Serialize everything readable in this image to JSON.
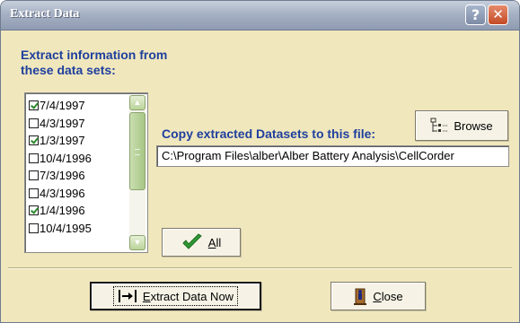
{
  "window": {
    "title": "Extract Data",
    "help_label": "?",
    "close_label": "✕"
  },
  "datasets": {
    "header_line1": "Extract information from",
    "header_line2": "these data sets:",
    "items": [
      {
        "label": "7/4/1997",
        "checked": true
      },
      {
        "label": "4/3/1997",
        "checked": false
      },
      {
        "label": "1/3/1997",
        "checked": true
      },
      {
        "label": "10/4/1996",
        "checked": false
      },
      {
        "label": "7/3/1996",
        "checked": false
      },
      {
        "label": "4/3/1996",
        "checked": false
      },
      {
        "label": "1/4/1996",
        "checked": true
      },
      {
        "label": "10/4/1995",
        "checked": false
      }
    ]
  },
  "copy": {
    "label": "Copy extracted Datasets to this file:",
    "path": "C:\\Program Files\\alber\\Alber Battery Analysis\\CellCorder"
  },
  "buttons": {
    "browse": "Browse",
    "all_u": "A",
    "all_rest": "ll",
    "extract_u": "E",
    "extract_rest": "xtract Data Now",
    "close_u": "C",
    "close_rest": "lose"
  },
  "colors": {
    "background": "#f0e7bd",
    "label_blue": "#1f3f9e",
    "titlebar": "#a6b1c4"
  },
  "icons": {
    "browse": "tree-browse-icon",
    "all": "green-checkmark-icon",
    "extract": "extract-arrow-icon",
    "close": "door-exit-icon"
  }
}
